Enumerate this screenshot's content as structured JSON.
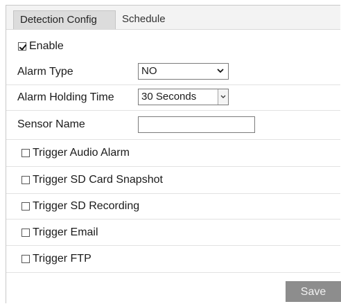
{
  "tabs": {
    "detection_config": "Detection Config",
    "schedule": "Schedule"
  },
  "enable": {
    "label": "Enable",
    "checked": true
  },
  "alarm_type": {
    "label": "Alarm Type",
    "value": "NO"
  },
  "alarm_holding_time": {
    "label": "Alarm Holding Time",
    "value": "30 Seconds"
  },
  "sensor_name": {
    "label": "Sensor Name",
    "value": ""
  },
  "triggers": [
    {
      "label": "Trigger Audio Alarm",
      "checked": false
    },
    {
      "label": "Trigger SD Card Snapshot",
      "checked": false
    },
    {
      "label": "Trigger SD Recording",
      "checked": false
    },
    {
      "label": "Trigger Email",
      "checked": false
    },
    {
      "label": "Trigger FTP",
      "checked": false
    }
  ],
  "save_label": "Save",
  "colors": {
    "tab_active_bg": "#dcdcdc",
    "save_bg": "#8d8d8d"
  }
}
